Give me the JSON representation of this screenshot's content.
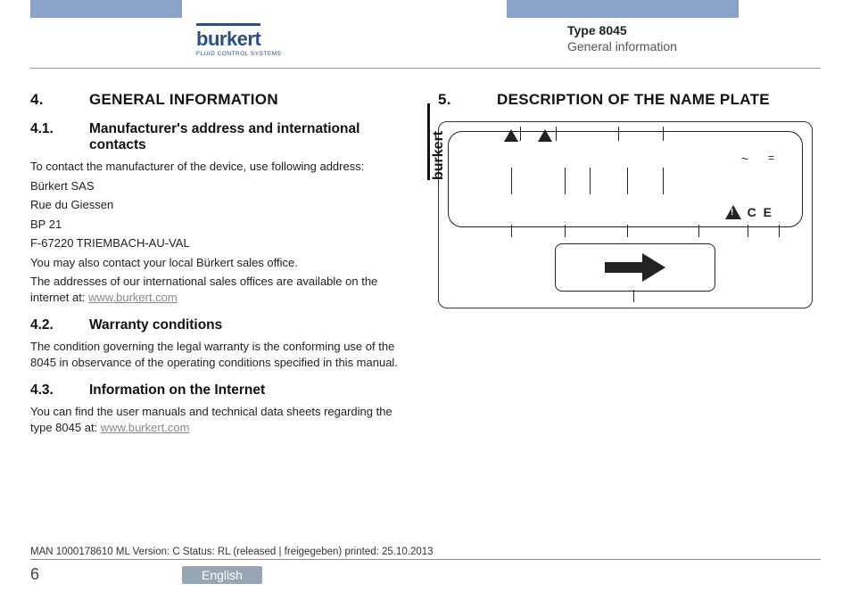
{
  "header": {
    "logo_text": "burkert",
    "logo_tag": "FLUID CONTROL SYSTEMS",
    "doc_type": "Type 8045",
    "doc_section": "General information"
  },
  "left": {
    "sec_num": "4.",
    "sec_title": "GENERAL INFORMATION",
    "s41_num": "4.1.",
    "s41_title": "Manufacturer's address and international contacts",
    "s41_p1": "To contact the manufacturer of the device, use following address:",
    "s41_p2": "Bürkert SAS",
    "s41_p3": "Rue du Giessen",
    "s41_p4": "BP 21",
    "s41_p5": "F-67220 TRIEMBACH-AU-VAL",
    "s41_p6": "You may also contact your local Bürkert sales office.",
    "s41_p7a": "The addresses of our international sales offices are available on the internet at: ",
    "s41_link": "www.burkert.com",
    "s42_num": "4.2.",
    "s42_title": "Warranty conditions",
    "s42_p": "The condition governing the legal warranty is the conforming use of the 8045 in observance of the operating conditions specified in this manual.",
    "s43_num": "4.3.",
    "s43_title": "Information on the Internet",
    "s43_p_a": "You can find the user manuals and technical data sheets regarding the type 8045 at: ",
    "s43_link": "www.burkert.com"
  },
  "right": {
    "sec_num": "5.",
    "sec_title": "DESCRIPTION OF THE NAME PLATE",
    "symbols": {
      "tilde": "~",
      "eq": "=",
      "ce": "C E"
    }
  },
  "footer": {
    "meta": "MAN 1000178610 ML Version: C Status: RL (released | freigegeben) printed: 25.10.2013",
    "page": "6",
    "lang": "English"
  }
}
